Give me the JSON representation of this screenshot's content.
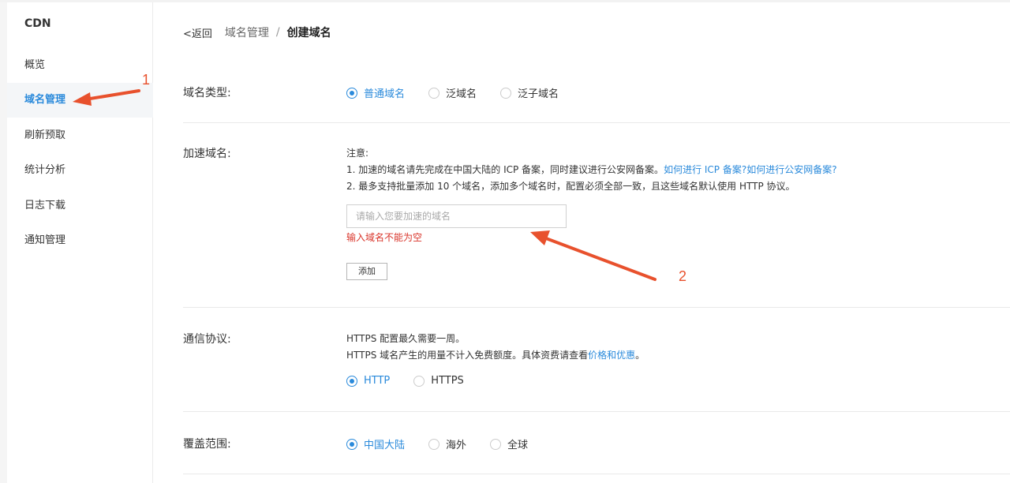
{
  "sidebar": {
    "title": "CDN",
    "items": [
      {
        "label": "概览"
      },
      {
        "label": "域名管理"
      },
      {
        "label": "刷新预取"
      },
      {
        "label": "统计分析"
      },
      {
        "label": "日志下载"
      },
      {
        "label": "通知管理"
      }
    ],
    "active_index": 1
  },
  "breadcrumb": {
    "back": "返回",
    "parent": "域名管理",
    "separator": "/",
    "current": "创建域名"
  },
  "domain_type": {
    "label": "域名类型:",
    "options": [
      "普通域名",
      "泛域名",
      "泛子域名"
    ],
    "selected": "普通域名"
  },
  "accelerate": {
    "label": "加速域名:",
    "note_title": "注意:",
    "note1_text": "1. 加速的域名请先完成在中国大陆的 ICP 备案，同时建议进行公安网备案。",
    "note1_link1": "如何进行 ICP 备案?",
    "note1_link2": "如何进行公安网备案?",
    "note2_text": "2. 最多支持批量添加 10 个域名，添加多个域名时，配置必须全部一致，且这些域名默认使用 HTTP 协议。",
    "input_value": "",
    "input_placeholder": "请输入您要加速的域名",
    "error": "输入域名不能为空",
    "add_button": "添加"
  },
  "protocol": {
    "label": "通信协议:",
    "line1": "HTTPS 配置最久需要一周。",
    "line2_text": "HTTPS 域名产生的用量不计入免费额度。具体资费请查看",
    "line2_link": "价格和优惠",
    "line2_end": "。",
    "options": [
      "HTTP",
      "HTTPS"
    ],
    "selected": "HTTP"
  },
  "coverage": {
    "label": "覆盖范围:",
    "options": [
      "中国大陆",
      "海外",
      "全球"
    ],
    "selected": "中国大陆"
  },
  "annotations": {
    "marker1": "1",
    "marker2": "2",
    "color": "#e8512d"
  },
  "colors": {
    "accent": "#2a8adb",
    "error": "#d9352b",
    "annotation": "#e8512d"
  }
}
